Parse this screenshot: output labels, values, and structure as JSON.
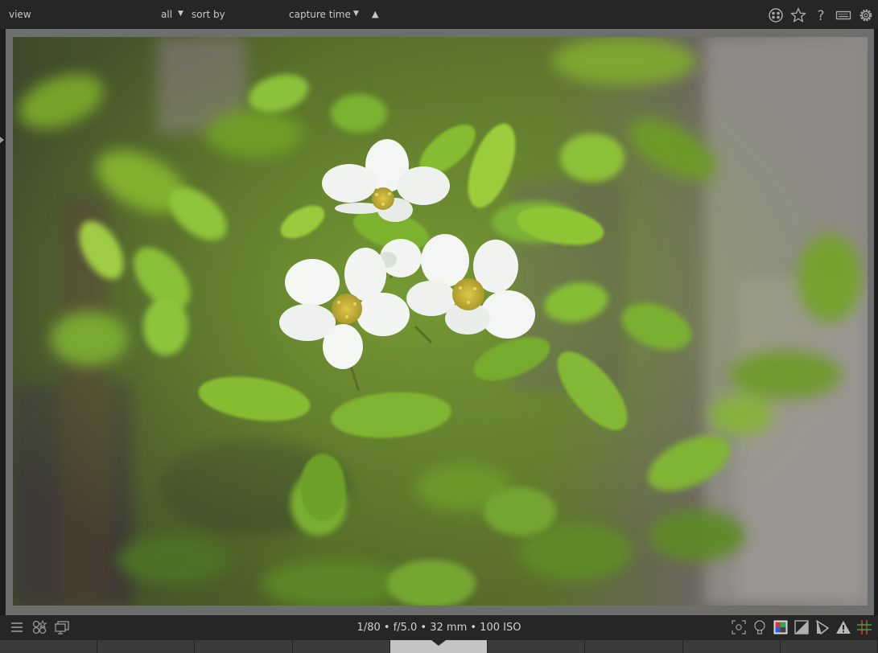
{
  "toolbar": {
    "view_label": "view",
    "filter_value": "all",
    "sort_label": "sort by",
    "sort_value": "capture time",
    "sort_direction": "ascending",
    "icons": [
      "color-labels-icon",
      "star-icon",
      "help-icon",
      "keyboard-icon",
      "gear-icon"
    ]
  },
  "image": {
    "subject": "white blossoms with green leaves"
  },
  "status": {
    "exif": "1/80 • f/5.0 • 32 mm • 100 ISO"
  },
  "bottom_left_icons": [
    "menu-icon",
    "styles-icon",
    "display-icon"
  ],
  "bottom_right_icons": [
    "focus-peaking-icon",
    "bulb-icon",
    "color-assessment-icon",
    "exposure-icon",
    "softproof-icon",
    "gamut-check-icon",
    "guides-icon"
  ],
  "tabs": {
    "count": 9,
    "active_index": 4
  },
  "colors": {
    "background": "#202020",
    "bar": "#262626",
    "frame": "#6e6e6e",
    "leaf_green": "#7fb02a",
    "petal_white": "#f4f6f4",
    "center_yellow": "#c9b43a",
    "guides_red": "#d23a2a",
    "guides_green": "#2ea84a"
  }
}
